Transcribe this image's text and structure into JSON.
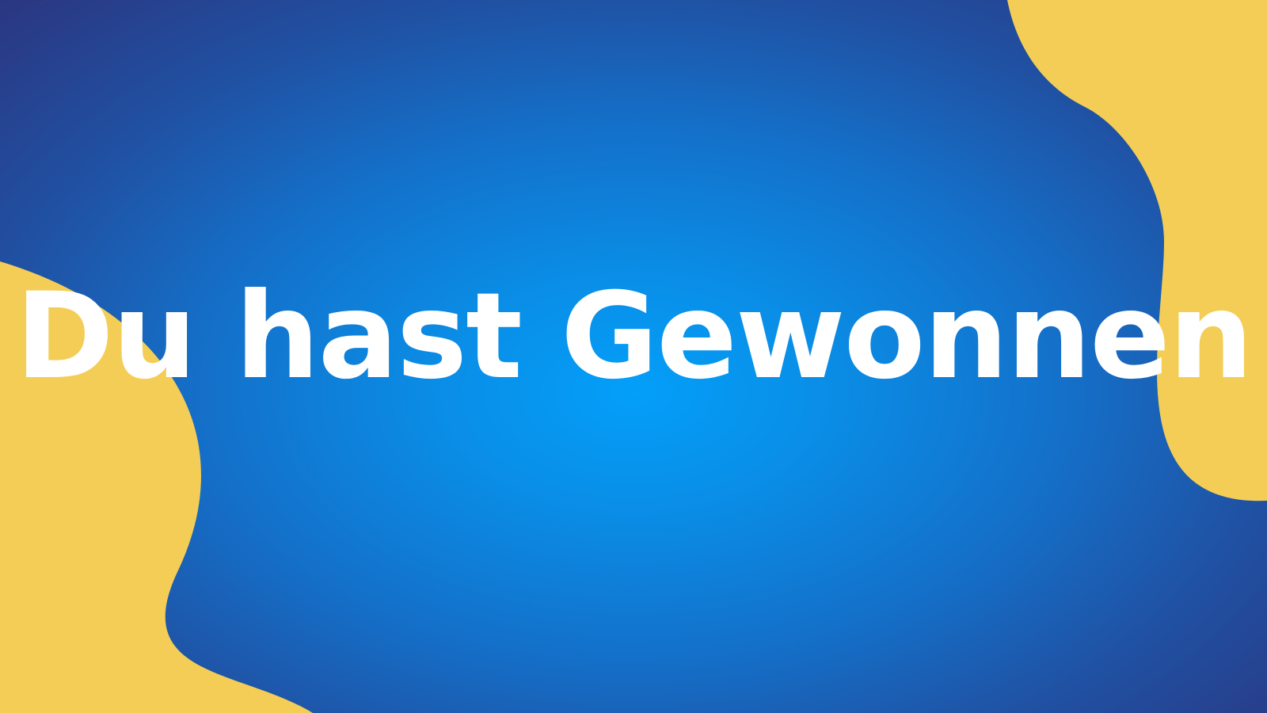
{
  "colors": {
    "background_center": "#039ff9",
    "background_edge": "#2b3680",
    "accent_shape": "#f4cd56",
    "text": "#ffffff"
  },
  "headline": {
    "text": "Du hast Gewonnen"
  },
  "decorations": [
    {
      "name": "bottom-left-blob",
      "shape": "organic wave"
    },
    {
      "name": "top-right-blob",
      "shape": "organic wave"
    }
  ]
}
